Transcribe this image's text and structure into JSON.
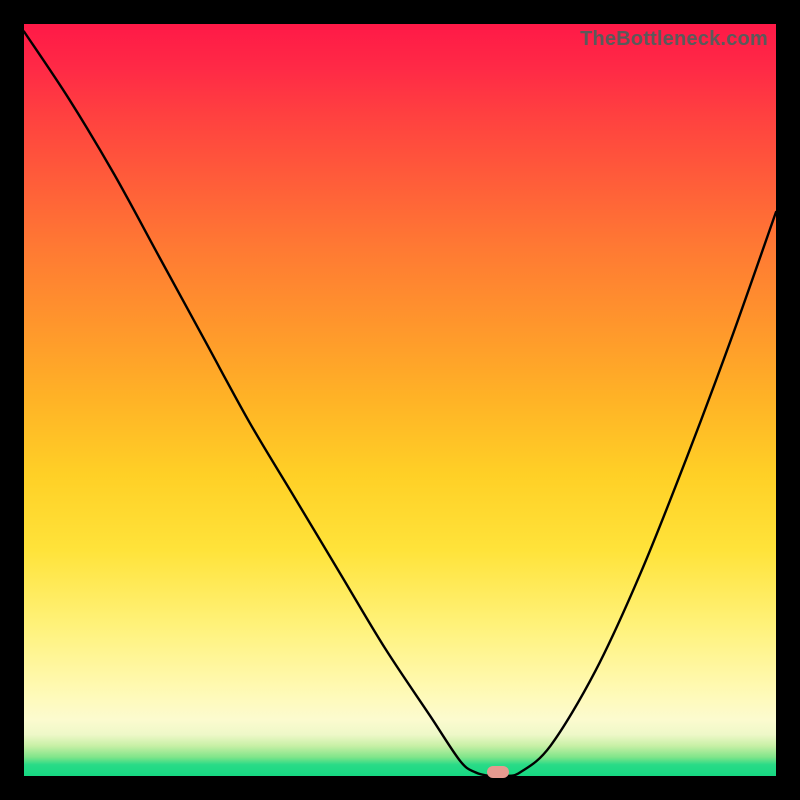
{
  "watermark": "TheBottleneck.com",
  "colors": {
    "frame": "#000000",
    "curve": "#000000",
    "marker": "#e69a90",
    "watermark": "#5a5a5a"
  },
  "chart_data": {
    "type": "line",
    "title": "",
    "xlabel": "",
    "ylabel": "",
    "xlim": [
      0,
      100
    ],
    "ylim": [
      0,
      100
    ],
    "grid": false,
    "series": [
      {
        "name": "bottleneck-curve",
        "x": [
          0,
          6,
          12,
          18,
          24,
          30,
          36,
          42,
          48,
          54,
          58,
          60,
          62,
          64,
          66,
          70,
          76,
          82,
          88,
          94,
          100
        ],
        "values": [
          99,
          90,
          80,
          69,
          58,
          47,
          37,
          27,
          17,
          8,
          2,
          0.5,
          0,
          0,
          0.5,
          4,
          14,
          27,
          42,
          58,
          75
        ]
      }
    ],
    "marker": {
      "x": 63,
      "y": 0.5
    },
    "background_gradient": {
      "orientation": "vertical",
      "stops": [
        {
          "pct": 0,
          "color": "#ff1947"
        },
        {
          "pct": 50,
          "color": "#ffb326"
        },
        {
          "pct": 92.5,
          "color": "#fcfbcf"
        },
        {
          "pct": 100,
          "color": "#16d882"
        }
      ]
    }
  }
}
